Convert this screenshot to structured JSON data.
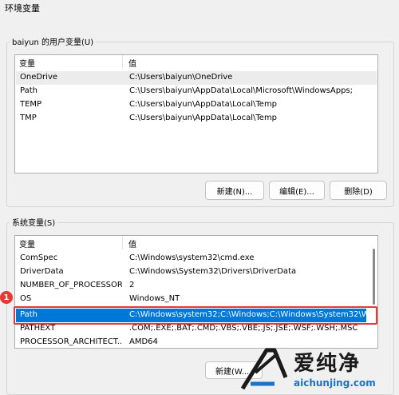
{
  "window": {
    "title": "环境变量"
  },
  "user_vars": {
    "group_label": "baiyun 的用户变量(U)",
    "columns": [
      "变量",
      "值"
    ],
    "rows": [
      {
        "name": "OneDrive",
        "value": "C:\\Users\\baiyun\\OneDrive"
      },
      {
        "name": "Path",
        "value": "C:\\Users\\baiyun\\AppData\\Local\\Microsoft\\WindowsApps;"
      },
      {
        "name": "TEMP",
        "value": "C:\\Users\\baiyun\\AppData\\Local\\Temp"
      },
      {
        "name": "TMP",
        "value": "C:\\Users\\baiyun\\AppData\\Local\\Temp"
      }
    ],
    "buttons": {
      "new": "新建(N)...",
      "edit": "编辑(E)...",
      "delete": "删除(D)"
    }
  },
  "system_vars": {
    "group_label": "系统变量(S)",
    "columns": [
      "变量",
      "值"
    ],
    "rows": [
      {
        "name": "ComSpec",
        "value": "C:\\Windows\\system32\\cmd.exe"
      },
      {
        "name": "DriverData",
        "value": "C:\\Windows\\System32\\Drivers\\DriverData"
      },
      {
        "name": "NUMBER_OF_PROCESSORS",
        "value": "2"
      },
      {
        "name": "OS",
        "value": "Windows_NT"
      },
      {
        "name": "Path",
        "value": "C:\\Windows\\system32;C:\\Windows;C:\\Windows\\System32\\Wb..."
      },
      {
        "name": "PATHEXT",
        "value": ".COM;.EXE;.BAT;.CMD;.VBS;.VBE;.JS;.JSE;.WSF;.WSH;.MSC"
      },
      {
        "name": "PROCESSOR_ARCHITECT...",
        "value": "AMD64"
      }
    ],
    "buttons": {
      "new": "新建(W..."
    }
  },
  "annotations": {
    "badge1": "1"
  },
  "watermark": {
    "brand": "爱纯净",
    "url": "aichunjing.com"
  },
  "colors": {
    "selection": "#0078d7",
    "highlight": "#e53935"
  }
}
